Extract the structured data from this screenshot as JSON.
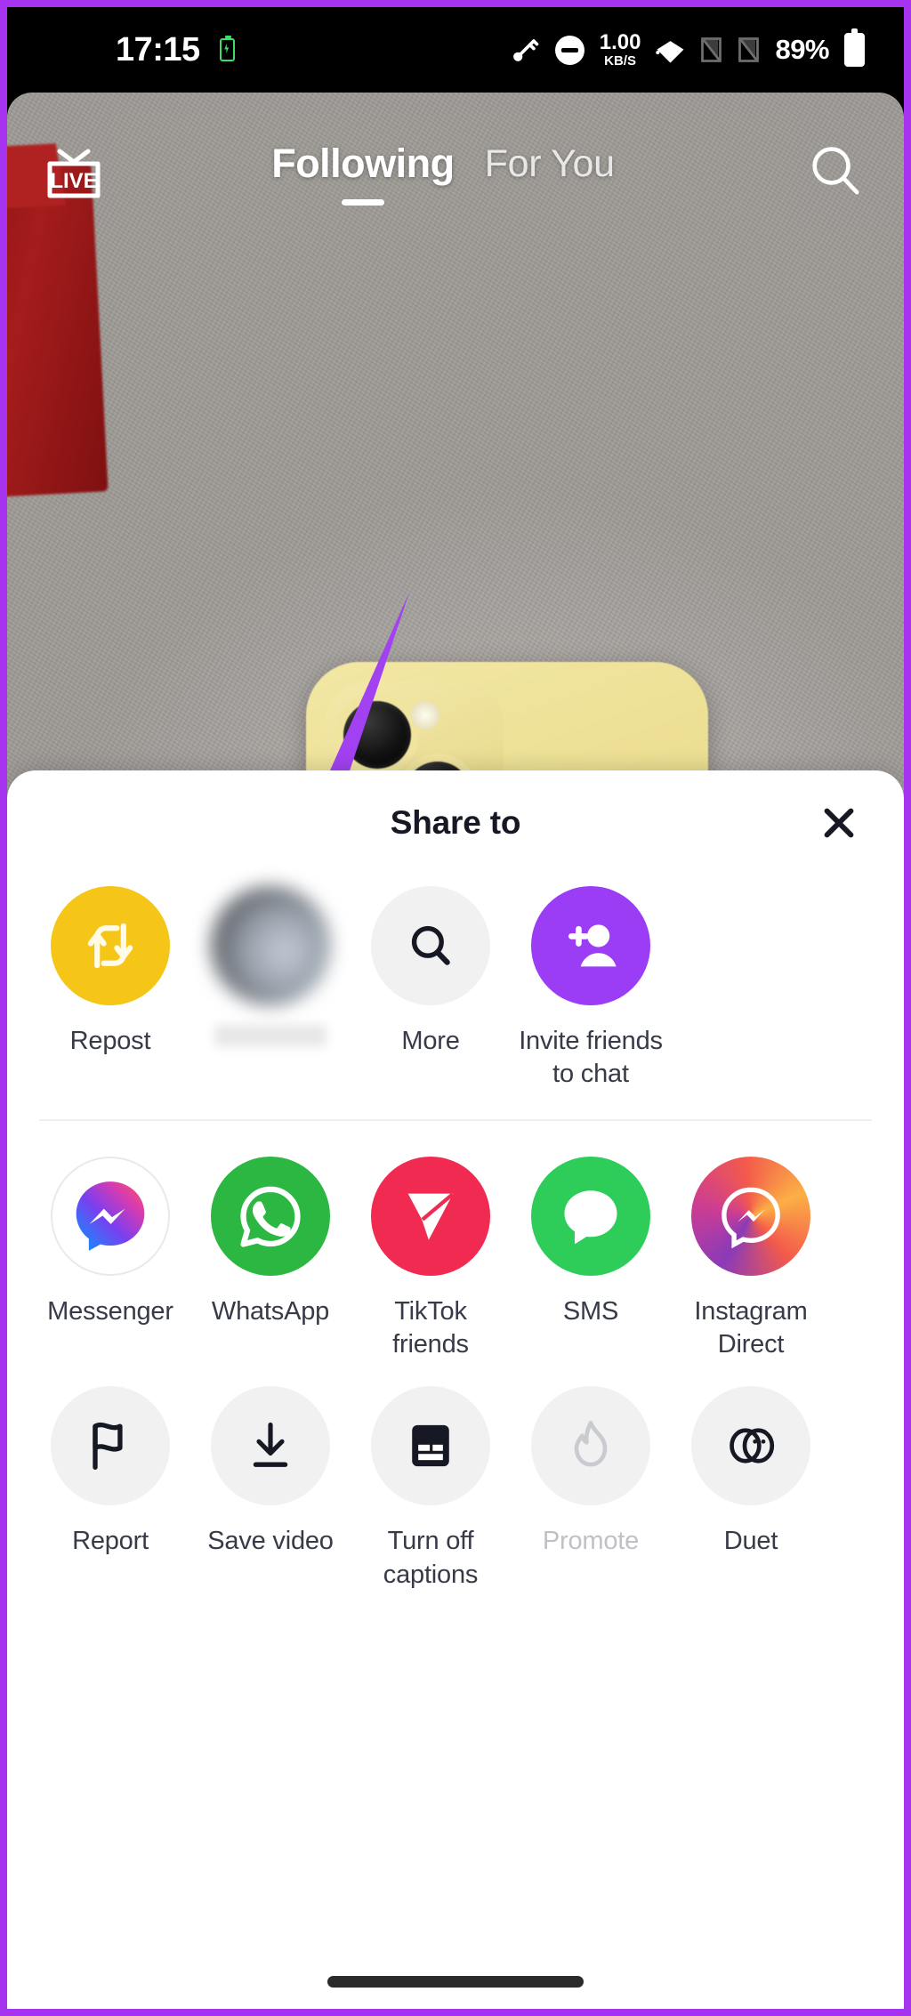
{
  "status_bar": {
    "time": "17:15",
    "net_speed_value": "1.00",
    "net_speed_unit": "KB/S",
    "battery_percent": "89%",
    "icons": [
      "battery-saver-icon",
      "vpn-key-icon",
      "do-not-disturb-icon",
      "wifi-icon",
      "sim1-icon",
      "sim2-icon",
      "battery-icon"
    ]
  },
  "feed_header": {
    "live_label": "LIVE",
    "tabs": [
      {
        "label": "Following",
        "active": true
      },
      {
        "label": "For You",
        "active": false
      }
    ],
    "search_icon": "search-icon"
  },
  "share_sheet": {
    "title": "Share to",
    "close_icon": "close-icon",
    "rows": [
      {
        "name": "primary-actions",
        "items": [
          {
            "label": "Repost",
            "icon": "repost-icon",
            "style": "c-repost",
            "dim": false
          },
          {
            "label": "",
            "icon": "contact-avatar-icon",
            "style": "blurred",
            "dim": false
          },
          {
            "label": "More",
            "icon": "search-icon",
            "style": "c-grey",
            "dim": false
          },
          {
            "label": "Invite friends\nto chat",
            "icon": "add-person-icon",
            "style": "c-purple",
            "dim": false
          }
        ]
      },
      {
        "name": "apps",
        "items": [
          {
            "label": "Messenger",
            "icon": "messenger-icon",
            "style": "c-msgr",
            "dim": false
          },
          {
            "label": "WhatsApp",
            "icon": "whatsapp-icon",
            "style": "c-whatsapp",
            "dim": false
          },
          {
            "label": "TikTok\nfriends",
            "icon": "tiktok-send-icon",
            "style": "c-tiktokf",
            "dim": false
          },
          {
            "label": "SMS",
            "icon": "sms-bubble-icon",
            "style": "c-sms",
            "dim": false
          },
          {
            "label": "Instagram\nDirect",
            "icon": "instagram-direct-icon",
            "style": "c-ig",
            "dim": false
          }
        ]
      },
      {
        "name": "actions",
        "items": [
          {
            "label": "Report",
            "icon": "flag-icon",
            "style": "c-light",
            "dim": false
          },
          {
            "label": "Save video",
            "icon": "download-icon",
            "style": "c-light",
            "dim": false
          },
          {
            "label": "Turn off\ncaptions",
            "icon": "captions-icon",
            "style": "c-light",
            "dim": false
          },
          {
            "label": "Promote",
            "icon": "flame-icon",
            "style": "c-light",
            "dim": true
          },
          {
            "label": "Duet",
            "icon": "duet-icon",
            "style": "c-light",
            "dim": false
          }
        ]
      }
    ]
  },
  "video": {
    "avatar_name": "creator-avatar",
    "annotation": "purple-arrow-pointing-to-repost"
  },
  "colors": {
    "accent_purple": "#9b3df5",
    "repost_yellow": "#f5c518",
    "frame_border": "#a533f0",
    "text_primary": "#161823",
    "text_secondary": "#373b47",
    "disabled": "#bfc1c7"
  }
}
